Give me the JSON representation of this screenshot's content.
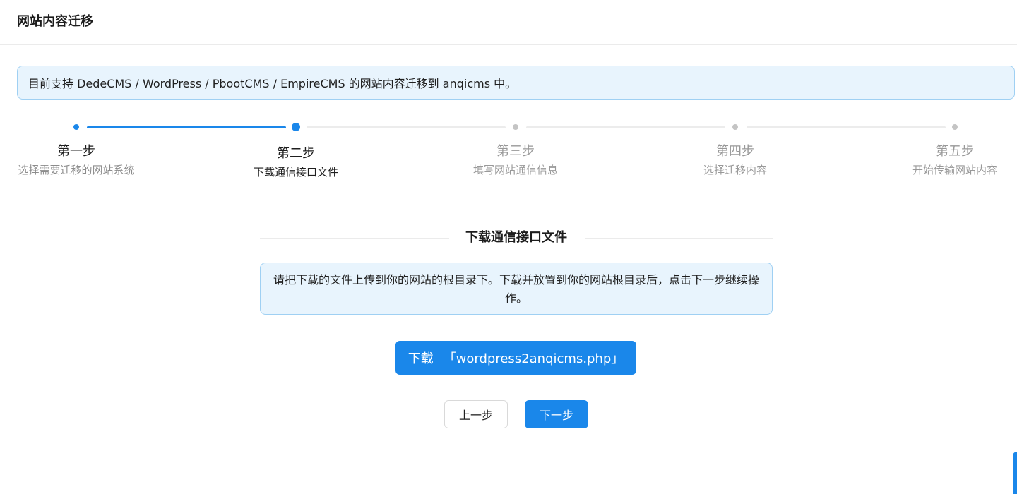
{
  "page": {
    "title": "网站内容迁移"
  },
  "top_alert": {
    "text": "目前支持 DedeCMS / WordPress / PbootCMS / EmpireCMS 的网站内容迁移到 anqicms 中。"
  },
  "steps": [
    {
      "title": "第一步",
      "description": "选择需要迁移的网站系统",
      "status": "done"
    },
    {
      "title": "第二步",
      "description": "下载通信接口文件",
      "status": "current"
    },
    {
      "title": "第三步",
      "description": "填写网站通信信息",
      "status": "waiting"
    },
    {
      "title": "第四步",
      "description": "选择迁移内容",
      "status": "waiting"
    },
    {
      "title": "第五步",
      "description": "开始传输网站内容",
      "status": "waiting"
    }
  ],
  "section": {
    "title": "下载通信接口文件",
    "info_text": "请把下载的文件上传到你的网站的根目录下。下载并放置到你的网站根目录后，点击下一步继续操作。",
    "download_label": "下载",
    "download_filename": "「wordpress2anqicms.php」"
  },
  "actions": {
    "prev_label": "上一步",
    "next_label": "下一步"
  },
  "colors": {
    "primary": "#1a87ea",
    "alert_bg": "#e8f4fd",
    "alert_border": "#9fd0f3",
    "muted": "#999999"
  }
}
